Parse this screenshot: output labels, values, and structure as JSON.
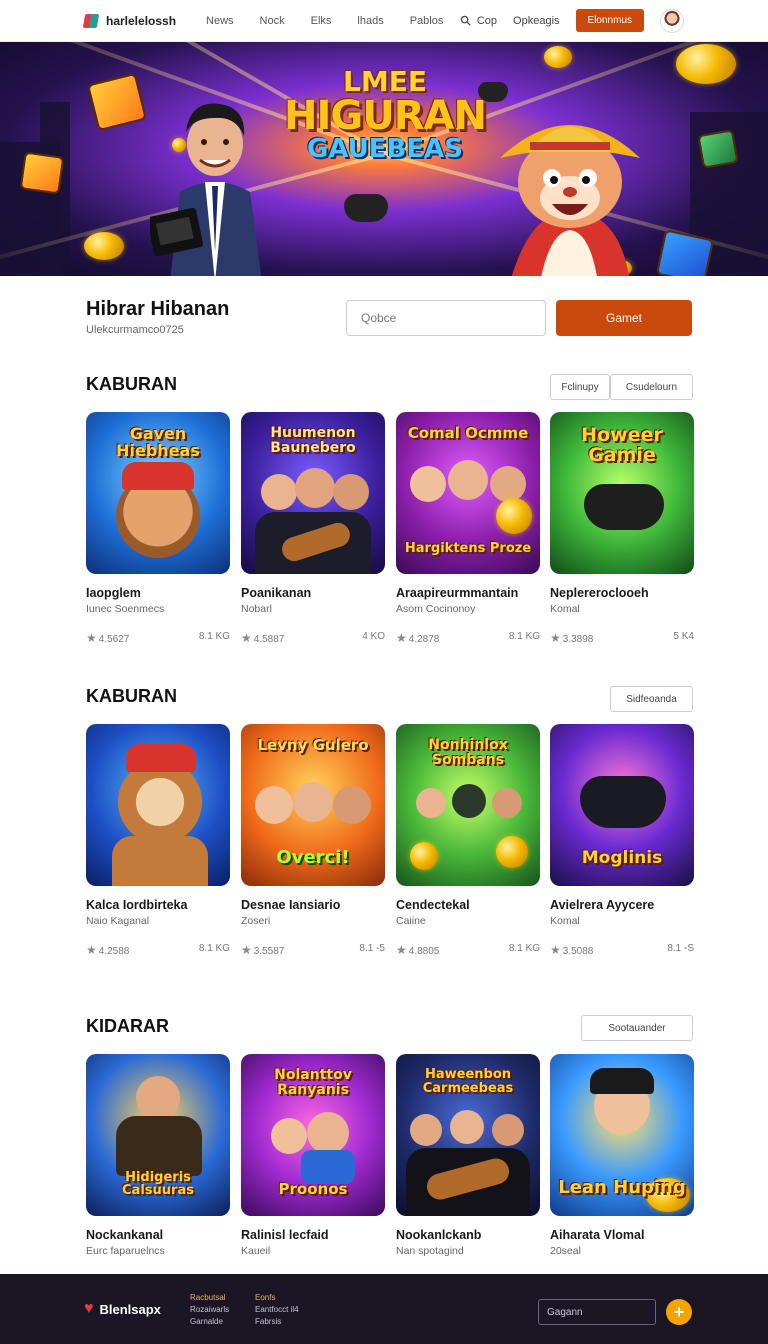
{
  "nav": {
    "brand": "harlelelossh",
    "links": [
      "News",
      "Nock",
      "Elks",
      "lhads",
      "Pablos"
    ],
    "search_label": "Cop",
    "opt_label": "Opkeagis",
    "cta": "Elonnmus"
  },
  "hero": {
    "line1": "LMEE",
    "line2": "HIGURAN",
    "line3": "GAUEBEAS"
  },
  "profile": {
    "title": "Hibrar Hibanan",
    "subtitle": "Ulekcurmamco0725",
    "search_placeholder": "Qobce",
    "button": "Gamet"
  },
  "sections": [
    {
      "title": "KABURAN",
      "buttons": [
        "Fclinupy",
        "Csudelourn"
      ],
      "cards": [
        {
          "art": "Gaven Hiebheas",
          "name": "Iaopglem",
          "sub": "Iunec Soenmecs",
          "rating": "4.5627",
          "meta": "8.1 KG"
        },
        {
          "art": "Huumenon Baunebero",
          "name": "Poanikanan",
          "sub": "Nobarl",
          "rating": "4.5887",
          "meta": "4 KO"
        },
        {
          "art": "Comal Ocmme",
          "art2": "Hargiktens Proze",
          "name": "Araapireurmmantain",
          "sub": "Asom Cocinonoy",
          "rating": "4.2878",
          "meta": "8.1 KG"
        },
        {
          "art": "Howeer Gamie",
          "name": "Neplereroclooeh",
          "sub": "Komal",
          "rating": "3.3898",
          "meta": "5 K4"
        }
      ]
    },
    {
      "title": "KABURAN",
      "buttons": [
        "Sidfeoanda"
      ],
      "cards": [
        {
          "art": "",
          "name": "Kalca Iordbirteka",
          "sub": "Naio Kaganal",
          "rating": "4.2588",
          "meta": "8.1 KG"
        },
        {
          "art": "Levny Gulero",
          "art2": "Overci!",
          "name": "Desnae Iansiario",
          "sub": "Zoseri",
          "rating": "3.5587",
          "meta": "8.1 -5"
        },
        {
          "art": "Nonhinlox Sombans",
          "name": "Cendectekal",
          "sub": "Caiine",
          "rating": "4.8805",
          "meta": "8.1 KG"
        },
        {
          "art": "",
          "art2": "Moglinis",
          "name": "Avielrera Ayycere",
          "sub": "Komal",
          "rating": "3.5088",
          "meta": "8.1 -S"
        }
      ]
    },
    {
      "title": "KIDARAR",
      "buttons": [
        "Sootauander"
      ],
      "cards": [
        {
          "art": "",
          "art2": "Hidigeris Calsuuras",
          "name": "Nockankanal",
          "sub": "Eurc faparuelncs",
          "rating": "",
          "meta": ""
        },
        {
          "art": "Nolanttov Ranyanis",
          "art2": "Proonos",
          "name": "Ralinisl lecfaid",
          "sub": "Kaueil",
          "rating": "",
          "meta": ""
        },
        {
          "art": "Haweenbon Carmeebeas",
          "name": "Nookanlckanb",
          "sub": "Nan spotagind",
          "rating": "",
          "meta": ""
        },
        {
          "art": "",
          "art2": "Lean Huping",
          "name": "Aiharata Vlomal",
          "sub": "20seal",
          "rating": "",
          "meta": ""
        }
      ]
    }
  ],
  "footer": {
    "brand": "Blenlsapx",
    "col1": [
      "Racbutsal",
      "Rozaiwarls",
      "Garnalde"
    ],
    "col2": [
      "Eonfs",
      "Eantfocct il4",
      "Fabrsis"
    ],
    "search_placeholder": "Gagann",
    "plus": "+"
  },
  "colors": {
    "accent": "#c94a0c",
    "footer_bg": "#1c1624",
    "gold": "#f5a300"
  }
}
